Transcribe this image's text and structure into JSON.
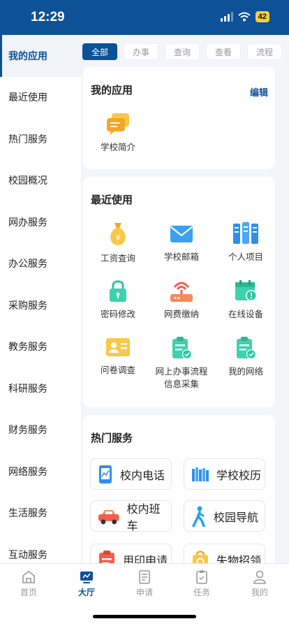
{
  "status": {
    "time": "12:29",
    "battery": "42"
  },
  "sidebar": {
    "items": [
      "我的应用",
      "最近使用",
      "热门服务",
      "校园概况",
      "网办服务",
      "办公服务",
      "采购服务",
      "教务服务",
      "科研服务",
      "财务服务",
      "网络服务",
      "生活服务",
      "互动服务"
    ]
  },
  "filters": [
    "全部",
    "办事",
    "查询",
    "查看",
    "流程"
  ],
  "my_apps": {
    "title": "我的应用",
    "edit": "编辑",
    "items": [
      "学校简介"
    ]
  },
  "recent": {
    "title": "最近使用",
    "items": [
      "工资查询",
      "学校邮箱",
      "个人项目",
      "密码修改",
      "网费缴纳",
      "在线设备",
      "问卷调查",
      "网上办事流程",
      "信息采集",
      "我的网络"
    ]
  },
  "hot": {
    "title": "热门服务",
    "items": [
      "校内电话",
      "学校校历",
      "校内班车",
      "校园导航",
      "用印申请",
      "失物招领"
    ]
  },
  "tabbar": [
    "首页",
    "大厅",
    "申请",
    "任务",
    "我的"
  ],
  "colors": {
    "brand": "#0d5196",
    "accent": "#f4d03f"
  }
}
